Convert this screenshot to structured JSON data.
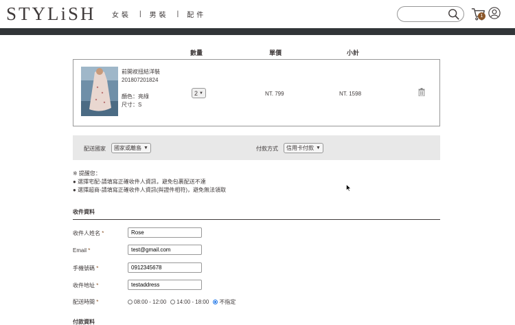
{
  "header": {
    "logo": "STYLiSH",
    "nav": [
      {
        "label": "女裝"
      },
      {
        "label": "男裝"
      },
      {
        "label": "配件"
      }
    ],
    "nav_separator": "|",
    "search_value": "",
    "cart_count": "1"
  },
  "cart": {
    "columns": {
      "quantity": "數量",
      "unit_price": "單價",
      "subtotal": "小計"
    },
    "item": {
      "name": "前開衩扭結洋裝",
      "id": "201807201824",
      "color": "顏色：亮綠",
      "size": "尺寸：S",
      "quantity": "2",
      "price": "NT. 799",
      "subtotal": "NT. 1598"
    }
  },
  "shipping": {
    "country_label": "配送國家",
    "country_value": "國家或離島",
    "payment_label": "付款方式",
    "payment_value": "信用卡付款"
  },
  "notice": {
    "title": "※ 提醒您：",
    "line1": "● 選擇宅配-請填寫正確收件人資訊，避免包裹配送不達",
    "line2": "● 選擇超商-請填寫正確收件人資訊(與證件相符)，避免無法領取"
  },
  "form": {
    "section_title": "收件資料",
    "name_label": "收件人姓名",
    "name_value": "Rose",
    "email_label": "Email",
    "email_value": "test@gmail.com",
    "phone_label": "手機號碼",
    "phone_value": "0912345678",
    "address_label": "收件地址",
    "address_value": "testaddress",
    "time_label": "配送時間",
    "required_mark": "*",
    "time_options": [
      "08:00 - 12:00",
      "14:00 - 18:00",
      "不指定"
    ],
    "time_selected": "不指定"
  },
  "payment_section": {
    "title": "付款資料"
  },
  "colors": {
    "brand_text": "#3f3a3a",
    "dark_bar": "#313538",
    "badge": "#8b572a",
    "ship_bar_bg": "#e8e8e8"
  }
}
